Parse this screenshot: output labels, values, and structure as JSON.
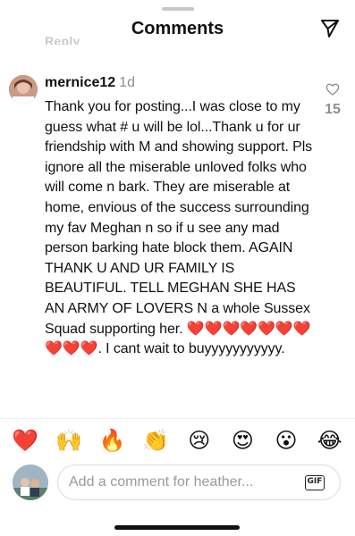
{
  "header": {
    "title": "Comments",
    "share_icon": "paper-plane-icon"
  },
  "previous_comment": {
    "reply_label_partial": "Reply"
  },
  "comment": {
    "username": "mernice12",
    "time_ago": "1d",
    "text": "Thank you for posting...I was close to my guess what # u will be lol...Thank u for ur friendship with M and showing support. Pls ignore all the miserable unloved folks who will come n bark. They are miserable at home,  envious of the success surrounding my fav Meghan n  so if u see any mad person barking hate block them. AGAIN THANK U AND UR FAMILY IS BEAUTIFUL. TELL MEGHAN SHE HAS AN ARMY OF LOVERS N a whole Sussex Squad supporting her. ❤️❤️❤️❤️❤️❤️❤️❤️❤️❤️. I cant wait  to buyyyyyyyyyyy.",
    "like_icon": "heart-outline-icon",
    "like_count": "15"
  },
  "emoji_bar": [
    "❤️",
    "🙌",
    "🔥",
    "👏",
    "😢",
    "😍",
    "😮",
    "😂"
  ],
  "composer": {
    "placeholder": "Add a comment for heather...",
    "gif_label": "GIF"
  }
}
